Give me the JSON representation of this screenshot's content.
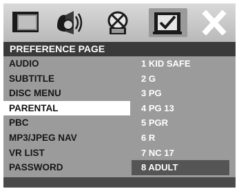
{
  "icons": [
    "general-setup-icon",
    "audio-setup-icon",
    "video-setup-icon",
    "preference-setup-icon",
    "exit-icon"
  ],
  "header": {
    "title": "PREFERENCE PAGE"
  },
  "menu": {
    "items": [
      "AUDIO",
      "SUBTITLE",
      "DISC MENU",
      "PARENTAL",
      "PBC",
      "MP3/JPEG NAV",
      "VR LIST",
      "PASSWORD"
    ],
    "selected": "PARENTAL"
  },
  "options": {
    "items": [
      "1 KID SAFE",
      "2 G",
      "3 PG",
      "4 PG 13",
      "5 PGR",
      "6 R",
      "7 NC 17",
      "8 ADULT"
    ],
    "selected": "8 ADULT"
  },
  "colors": {
    "panel": "#9b9b9b",
    "header": "#3a3a3a",
    "highlight": "#ffffff",
    "option_highlight": "#555555"
  }
}
